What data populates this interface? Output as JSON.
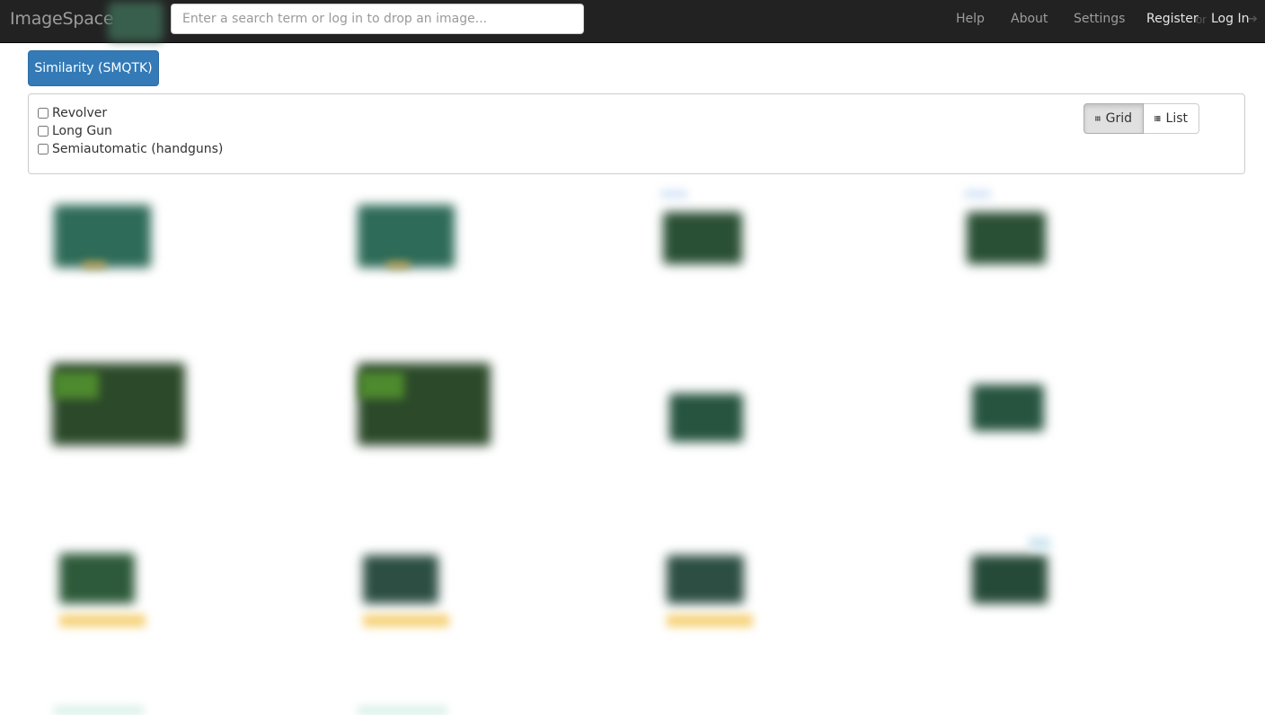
{
  "navbar": {
    "brand": "ImageSpace",
    "search_placeholder": "Enter a search term or log in to drop an image...",
    "links": [
      "Help",
      "About",
      "Settings"
    ],
    "register": "Register",
    "or": "or",
    "login": "Log In"
  },
  "similarity_button": "Similarity (SMQTK)",
  "filters": [
    "Revolver",
    "Long Gun",
    "Semiautomatic (handguns)"
  ],
  "view_toggle": {
    "grid": "Grid",
    "list": "List",
    "active": "grid"
  },
  "colors": {
    "navbar": "#222222",
    "primary": "#337ab7",
    "thumb_green": "#2f5a45"
  }
}
